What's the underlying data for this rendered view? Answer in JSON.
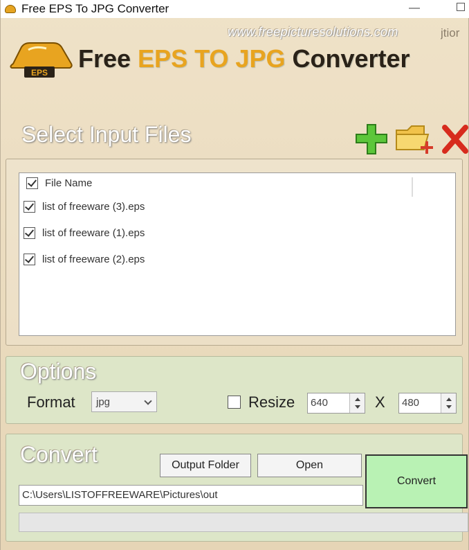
{
  "window": {
    "title": "Free EPS To JPG Converter",
    "minimize": "—",
    "accent_color": "#e8a420"
  },
  "header": {
    "website": "www.freepicturesolutions.com",
    "website_tail": "jtior",
    "title_part1": "Free ",
    "title_accent": "EPS TO JPG",
    "title_part2": " Converter",
    "logo_text": "EPS"
  },
  "input": {
    "heading": "Select Input Files",
    "add_icon": "plus-icon",
    "add_folder_icon": "folder-add-icon",
    "remove_icon": "remove-x-icon",
    "column_header": "File Name",
    "header_checked": true,
    "files": [
      {
        "name": "list of freeware (3).eps",
        "checked": true
      },
      {
        "name": "list of freeware (1).eps",
        "checked": true
      },
      {
        "name": "list of freeware (2).eps",
        "checked": true
      }
    ]
  },
  "options": {
    "heading": "Options",
    "format_label": "Format",
    "format_value": "jpg",
    "resize_label": "Resize",
    "resize_checked": false,
    "width": "640",
    "times": "X",
    "height": "480"
  },
  "convert": {
    "heading": "Convert",
    "output_folder_label": "Output Folder",
    "open_label": "Open",
    "convert_label": "Convert",
    "output_path": "C:\\Users\\LISTOFFREEWARE\\Pictures\\out",
    "progress": 0,
    "convert_color": "#b9f2b4"
  }
}
